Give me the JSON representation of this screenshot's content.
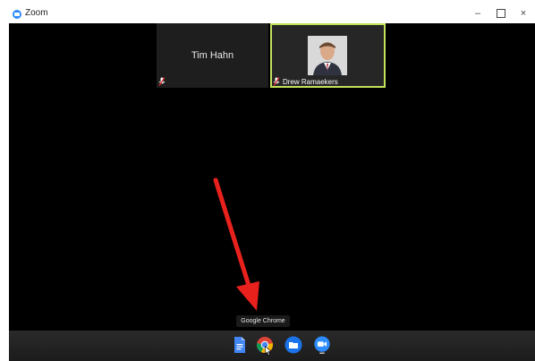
{
  "window": {
    "title": "Zoom",
    "minimize_glyph": "–",
    "close_glyph": "×"
  },
  "participants": [
    {
      "name": "Tim Hahn",
      "video": false,
      "muted": true
    },
    {
      "name": "Drew Ramaekers",
      "video": true,
      "muted": true,
      "active_speaker": true
    }
  ],
  "tooltip": {
    "text": "Google Chrome"
  },
  "shelf": {
    "apps": [
      {
        "name": "Google Docs",
        "icon": "docs-icon"
      },
      {
        "name": "Google Chrome",
        "icon": "chrome-icon",
        "hovered": true
      },
      {
        "name": "Files",
        "icon": "files-icon"
      },
      {
        "name": "Zoom",
        "icon": "zoom-icon",
        "running": true
      }
    ]
  },
  "colors": {
    "active_speaker_border": "#c2e35a",
    "arrow": "#e8211d",
    "zoom_blue": "#2d8cff"
  }
}
